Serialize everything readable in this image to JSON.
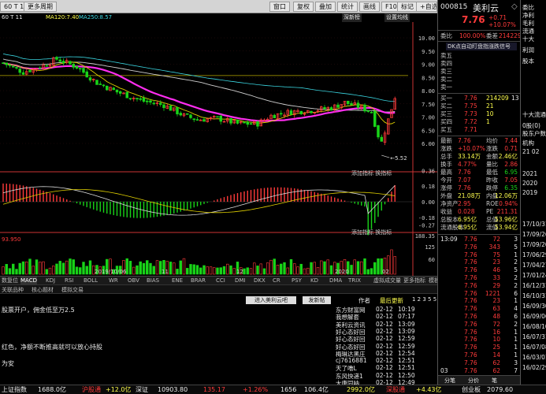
{
  "toolbar": {
    "period_label": "60 T 11",
    "more_period": "更多周期",
    "items": [
      "窗口",
      "复权",
      "叠加",
      "统计",
      "画线",
      "F10",
      "标记",
      "+自选",
      "返回"
    ],
    "deep_rank": "深新榜",
    "settings_line": "设置均线"
  },
  "indicators": {
    "ma120": "MA120:7.40",
    "ma250": "MA250:8.57"
  },
  "chart": {
    "price_labels": [
      "10.00",
      "9.50",
      "9.00",
      "8.50",
      "8.00",
      "7.50",
      "7.00",
      "6.50",
      "6.00"
    ],
    "low_label": "5.52",
    "macd_labels": [
      "0.36",
      "0.18",
      "0.00",
      "-0.18",
      "-0.27"
    ],
    "vol_labels": [
      "188.35",
      "125",
      "60"
    ],
    "date_labels": [
      "2019/10/06",
      "11",
      "12",
      "2020",
      "02"
    ],
    "indicator_buttons": [
      "添加指标",
      "换指标"
    ],
    "vol_left_value": "93.950"
  },
  "tabs1": {
    "items": [
      "数复位",
      "MACD",
      "KDJ",
      "RSI",
      "BOLL",
      "WR",
      "OBV",
      "BIAS",
      "ENE",
      "BRAR",
      "CCI",
      "DMI",
      "DKX",
      "CR",
      "PSY",
      "KD",
      "DMA",
      "TRIX",
      "虚拟成交量",
      "更多指标",
      "模板"
    ]
  },
  "tabs2": {
    "items": [
      "关联品种",
      "核心题材",
      "模拟交易"
    ]
  },
  "news": {
    "buttons": [
      "进入美利云吧",
      "发新帖"
    ],
    "header": [
      "作者",
      "最后更新",
      "1 2 3 5 5"
    ],
    "left_lines": [
      "股票开户，佣金低至万2.5",
      "红色，净额不断推高就可以放心持股",
      "为安"
    ],
    "rows": [
      {
        "author": "东方财富网",
        "date": "02-12",
        "time": "10:19"
      },
      {
        "author": "我想解套",
        "date": "02-12",
        "time": "07:17"
      },
      {
        "author": "美利云资讯",
        "date": "02-12",
        "time": "13:09"
      },
      {
        "author": "好心态好回",
        "date": "02-12",
        "time": "13:09"
      },
      {
        "author": "好心态好回",
        "date": "02-12",
        "time": "12:59"
      },
      {
        "author": "好心态好回",
        "date": "02-12",
        "time": "12:59"
      },
      {
        "author": "梅琳达黑庄",
        "date": "02-12",
        "time": "12:54"
      },
      {
        "author": "cj7616881",
        "date": "02-12",
        "time": "12:51"
      },
      {
        "author": "天了噜L",
        "date": "02-12",
        "time": "12:51"
      },
      {
        "author": "东风快递1",
        "date": "02-12",
        "time": "12:50"
      },
      {
        "author": "大唐同呐",
        "date": "02-12",
        "time": "12:49"
      }
    ]
  },
  "quote": {
    "code": "000815",
    "name": "美利云",
    "price": "7.76",
    "change": "+0.71",
    "change_pct": "+10.07%",
    "weibi_label": "委比",
    "weibi": "100.00%",
    "weicha_label": "委差",
    "weicha": "214229",
    "alert": "DK点自动盯盘指涨跌信号",
    "sell_labels": [
      "卖五",
      "卖四",
      "卖三",
      "卖二",
      "卖一"
    ],
    "buys": [
      {
        "label": "买一",
        "price": "7.76",
        "vol": "214209",
        "extra": "13"
      },
      {
        "label": "买二",
        "price": "7.75",
        "vol": "21",
        "extra": ""
      },
      {
        "label": "买三",
        "price": "7.73",
        "vol": "10",
        "extra": ""
      },
      {
        "label": "买四",
        "price": "7.72",
        "vol": "1",
        "extra": ""
      },
      {
        "label": "买五",
        "price": "7.71",
        "vol": "",
        "extra": ""
      }
    ],
    "stats": [
      {
        "l1": "最新",
        "v1": "7.76",
        "l2": "均价",
        "v2": "7.44"
      },
      {
        "l1": "涨跌",
        "v1": "+10.07%",
        "l2": "涨跌",
        "v2": "0.71"
      },
      {
        "l1": "总手",
        "v1": "33.14万",
        "l2": "金额",
        "v2": "2.46亿"
      },
      {
        "l1": "换手",
        "v1": "4.77%",
        "l2": "量比",
        "v2": "2.86"
      },
      {
        "l1": "最高",
        "v1": "7.76",
        "l2": "最低",
        "v2": "6.95"
      },
      {
        "l1": "今开",
        "v1": "7.07",
        "l2": "昨收",
        "v2": "7.05"
      },
      {
        "l1": "涨停",
        "v1": "7.76",
        "l2": "跌停",
        "v2": "6.35"
      },
      {
        "l1": "外盘",
        "v1": "21.08万",
        "l2": "内盘",
        "v2": "12.06万"
      },
      {
        "l1": "净资产",
        "v1": "2.95",
        "l2": "ROE",
        "v2": "0.94%"
      },
      {
        "l1": "收益",
        "v1": "0.028",
        "l2": "PE",
        "v2": "211.31"
      },
      {
        "l1": "总股本",
        "v1": "6.95亿",
        "l2": "总值",
        "v2": "53.96亿"
      },
      {
        "l1": "流通股本",
        "v1": "6.95亿",
        "l2": "流值",
        "v2": "53.94亿"
      }
    ],
    "ticks": [
      {
        "time": "13:09",
        "price": "7.76",
        "vol": "72",
        "n": "3"
      },
      {
        "time": "",
        "price": "7.76",
        "vol": "343",
        "n": "5"
      },
      {
        "time": "",
        "price": "7.76",
        "vol": "75",
        "n": "1"
      },
      {
        "time": "",
        "price": "7.76",
        "vol": "23",
        "n": "2"
      },
      {
        "time": "",
        "price": "7.76",
        "vol": "46",
        "n": "5"
      },
      {
        "time": "",
        "price": "7.76",
        "vol": "33",
        "n": "2"
      },
      {
        "time": "",
        "price": "7.76",
        "vol": "29",
        "n": "2"
      },
      {
        "time": "",
        "price": "7.76",
        "vol": "1221",
        "n": "6"
      },
      {
        "time": "",
        "price": "7.76",
        "vol": "23",
        "n": "1"
      },
      {
        "time": "",
        "price": "7.76",
        "vol": "63",
        "n": "4"
      },
      {
        "time": "",
        "price": "7.76",
        "vol": "48",
        "n": "6"
      },
      {
        "time": "",
        "price": "7.76",
        "vol": "72",
        "n": "2"
      },
      {
        "time": "",
        "price": "7.76",
        "vol": "16",
        "n": "1"
      },
      {
        "time": "",
        "price": "7.76",
        "vol": "10",
        "n": "1"
      },
      {
        "time": "",
        "price": "7.76",
        "vol": "25",
        "n": "1"
      },
      {
        "time": "",
        "price": "7.76",
        "vol": "14",
        "n": "1"
      },
      {
        "time": "",
        "price": "7.76",
        "vol": "62",
        "n": "3"
      },
      {
        "time": "03",
        "price": "7.76",
        "vol": "62",
        "n": "7"
      }
    ],
    "bottom_tabs": [
      "分笔",
      "分价",
      "笔"
    ]
  },
  "far": {
    "items": [
      "委比",
      "净利",
      "毛利",
      "流通",
      "十大",
      "利润",
      "股本",
      "十大流通",
      "0股(0)",
      "股东户数",
      "机构",
      "21 02",
      "2021",
      "2020",
      "2019"
    ],
    "dates": [
      "17/10/31",
      "17/09/26",
      "17/09/20",
      "17/06/29",
      "17/04/27",
      "17/01/24",
      "16/12/31",
      "16/10/31",
      "16/09/30",
      "16/09/06",
      "16/08/10",
      "16/07/31",
      "16/07/08",
      "16/03/01",
      "16/02/29"
    ]
  },
  "status": {
    "items": [
      {
        "text": "上证指数",
        "color": "white"
      },
      {
        "text": "1688.0亿",
        "color": "white"
      },
      {
        "text": "沪股通",
        "color": "red"
      },
      {
        "text": "+12.0亿",
        "color": "yellow"
      },
      {
        "text": "深证",
        "color": "white"
      },
      {
        "text": "10903.80",
        "color": "white"
      },
      {
        "text": "135.17",
        "color": "red"
      },
      {
        "text": "+1.26%",
        "color": "red"
      },
      {
        "text": "1656",
        "color": "white"
      },
      {
        "text": "106.4亿",
        "color": "white"
      },
      {
        "text": "2992.0亿",
        "color": "yellow"
      },
      {
        "text": "深股通",
        "color": "red"
      },
      {
        "text": "+4.43亿",
        "color": "yellow"
      },
      {
        "text": "创业板",
        "color": "white"
      },
      {
        "text": "2079.60",
        "color": "white"
      }
    ]
  },
  "colors": {
    "up": "#ff3b3b",
    "down": "#19d419",
    "ma_magenta": "#ff2df0",
    "ma_yellow": "#e0d000",
    "ma_white": "#d0d0d0",
    "ma_cyan": "#3ad5e0"
  }
}
